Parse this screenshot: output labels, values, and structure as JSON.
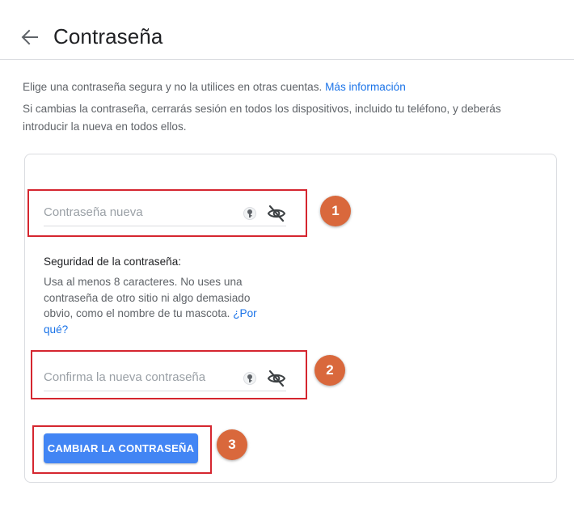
{
  "header": {
    "title": "Contraseña",
    "back_icon": "arrow-left-icon"
  },
  "intro": {
    "line1": "Elige una contraseña segura y no la utilices en otras cuentas.",
    "learn_more": "Más información",
    "line2": "Si cambias la contraseña, cerrarás sesión en todos los dispositivos, incluido tu teléfono, y deberás introducir la nueva en todos ellos."
  },
  "form": {
    "new_password": {
      "placeholder": "Contraseña nueva",
      "key_icon": "password-key-icon",
      "visibility_icon": "eye-off-icon"
    },
    "strength": {
      "title": "Seguridad de la contraseña:",
      "text": "Usa al menos 8 caracteres. No uses una contraseña de otro sitio ni algo demasiado obvio, como el nombre de tu mascota.",
      "why_link": "¿Por qué?"
    },
    "confirm_password": {
      "placeholder": "Confirma la nueva contraseña",
      "key_icon": "password-key-icon",
      "visibility_icon": "eye-off-icon"
    },
    "submit_label": "CAMBIAR LA CONTRASEÑA"
  },
  "annotations": {
    "step1": "1",
    "step2": "2",
    "step3": "3",
    "highlight_color": "#d5262f",
    "badge_color": "#d9683c"
  },
  "colors": {
    "accent": "#4285f4",
    "link": "#1a73e8"
  }
}
